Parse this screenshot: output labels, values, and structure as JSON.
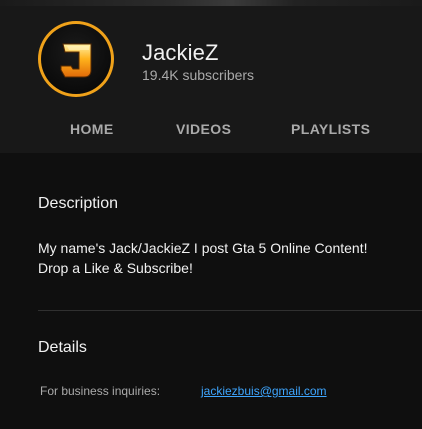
{
  "channel": {
    "name": "JackieZ",
    "subscribers": "19.4K subscribers",
    "avatar_letter": "J"
  },
  "tabs": [
    {
      "label": "HOME"
    },
    {
      "label": "VIDEOS"
    },
    {
      "label": "PLAYLISTS"
    }
  ],
  "about": {
    "description_heading": "Description",
    "description_lines": [
      "My name's Jack/JackieZ I post Gta 5 Online Content!",
      "Drop a Like & Subscribe!"
    ],
    "details_heading": "Details",
    "business_label": "For business inquiries:",
    "business_email": "jackiezbuis@gmail.com"
  },
  "colors": {
    "background": "#0f0f0f",
    "header_background": "#181818",
    "text_primary": "#f1f1f1",
    "text_secondary": "#aaaaaa",
    "link": "#3ea6ff",
    "avatar_ring": "#f0a21a"
  }
}
